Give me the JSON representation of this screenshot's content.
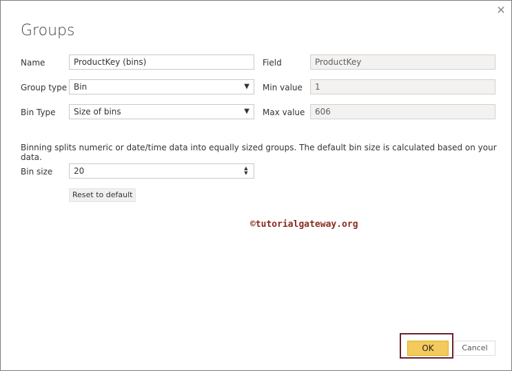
{
  "dialog": {
    "title": "Groups",
    "close_icon": "close-icon"
  },
  "form": {
    "name_label": "Name",
    "name_value": "ProductKey (bins)",
    "group_type_label": "Group type",
    "group_type_value": "Bin",
    "bin_type_label": "Bin Type",
    "bin_type_value": "Size of bins",
    "field_label": "Field",
    "field_value": "ProductKey",
    "min_label": "Min value",
    "min_value": "1",
    "max_label": "Max value",
    "max_value": "606",
    "description": "Binning splits numeric or date/time data into equally sized groups. The default bin size is calculated based on your data.",
    "bin_size_label": "Bin size",
    "bin_size_value": "20",
    "reset_label": "Reset to default"
  },
  "watermark": "©tutorialgateway.org",
  "footer": {
    "ok_label": "OK",
    "cancel_label": "Cancel"
  },
  "colors": {
    "ok_background": "#f4c95d",
    "highlight_frame": "#6b1f2a",
    "watermark": "#8b2a1e"
  }
}
